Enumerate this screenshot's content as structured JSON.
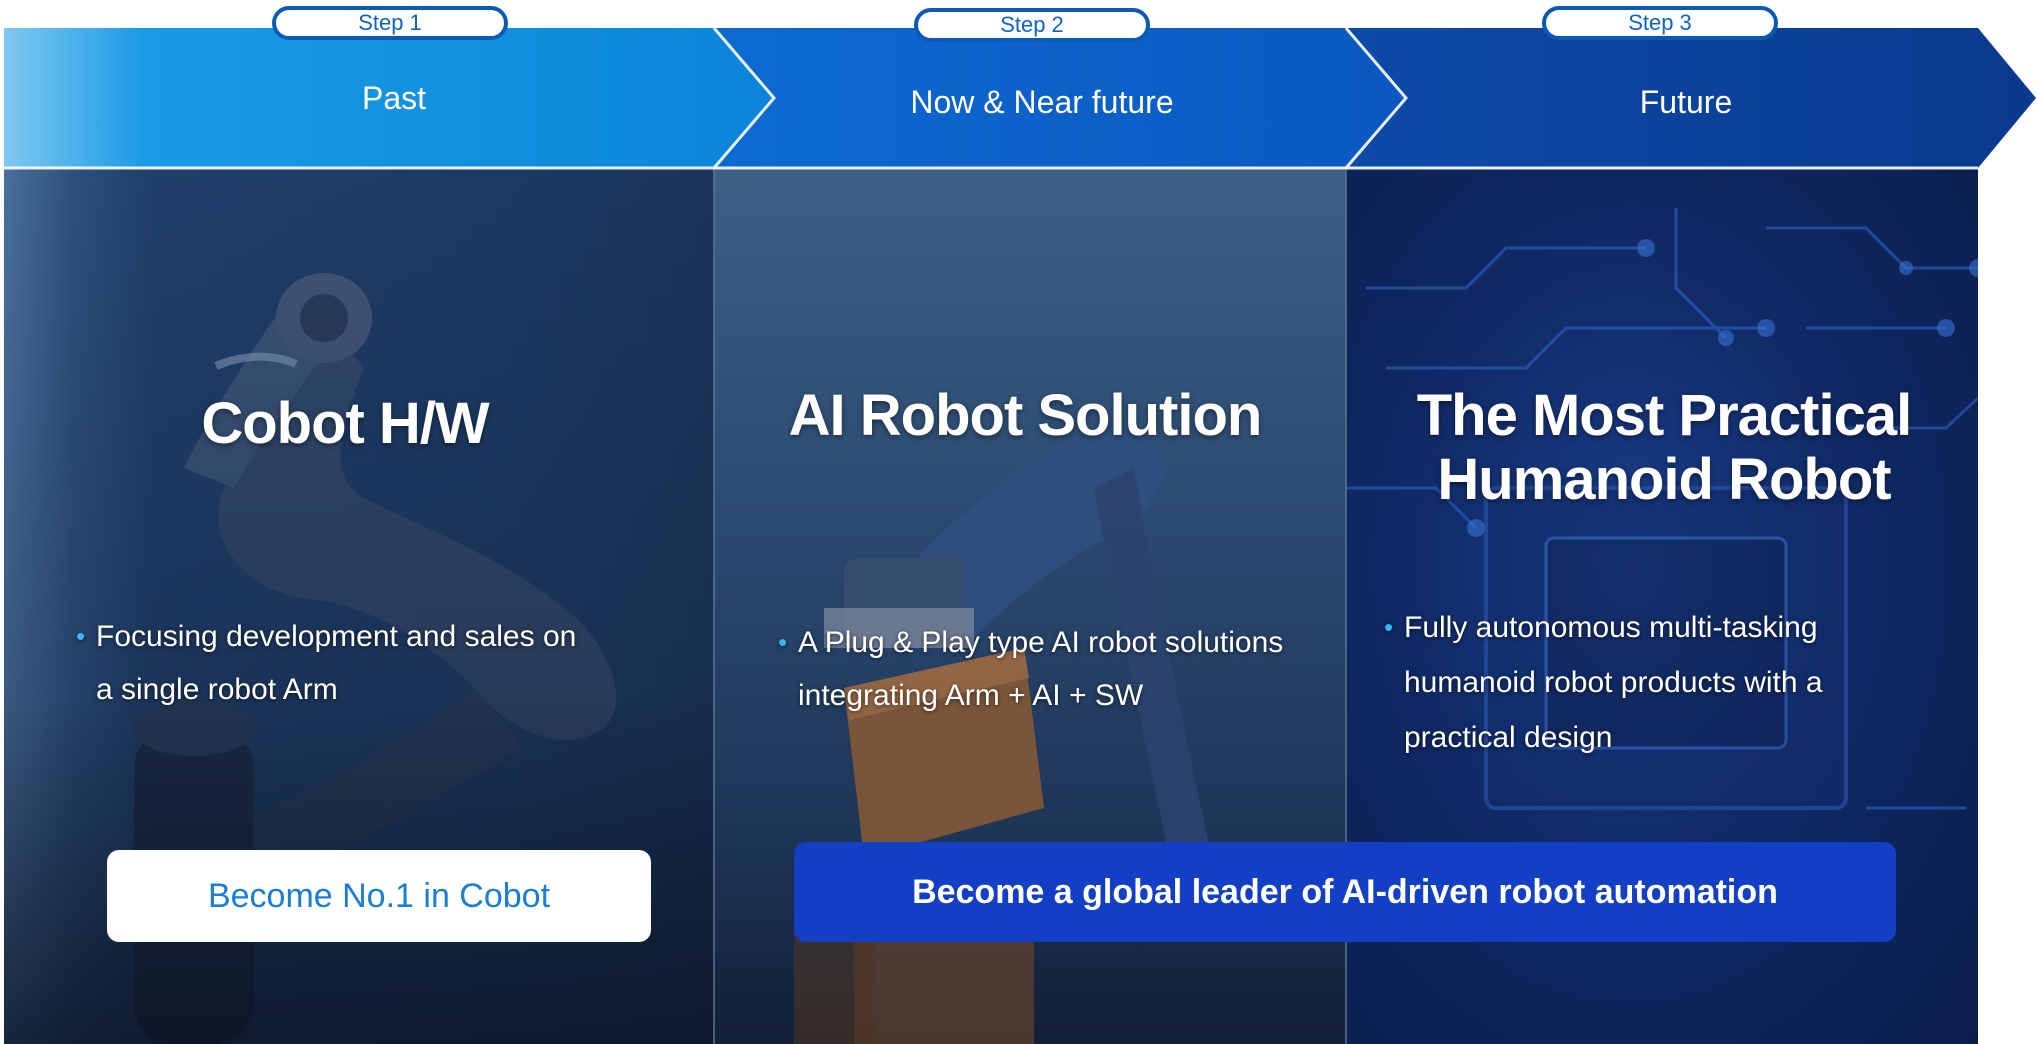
{
  "steps": [
    {
      "step_label": "Step 1",
      "period": "Past"
    },
    {
      "step_label": "Step 2",
      "period": "Now & Near future"
    },
    {
      "step_label": "Step 3",
      "period": "Future"
    }
  ],
  "panels": [
    {
      "title": "Cobot H/W",
      "bullet": [
        "Focusing development and sales on",
        "a single robot Arm"
      ]
    },
    {
      "title": "AI Robot Solution",
      "bullet": [
        "A Plug & Play type AI robot solutions",
        "integrating Arm + AI + SW"
      ]
    },
    {
      "title": [
        "The Most Practical",
        "Humanoid Robot"
      ],
      "bullet": [
        "Fully autonomous multi-tasking",
        "humanoid robot products with a",
        "practical design"
      ]
    }
  ],
  "goals": {
    "goal_1": "Become No.1 in Cobot",
    "goal_2": "Become a global leader of AI-driven robot automation"
  },
  "colors": {
    "chevron_1": "#0a8ee0",
    "chevron_2": "#0b5fc8",
    "chevron_3": "#0a3f96",
    "bullet_dot": "#35b6ee",
    "goal_blue": "#133fc4",
    "goal_white_text": "#1a7ed4"
  }
}
